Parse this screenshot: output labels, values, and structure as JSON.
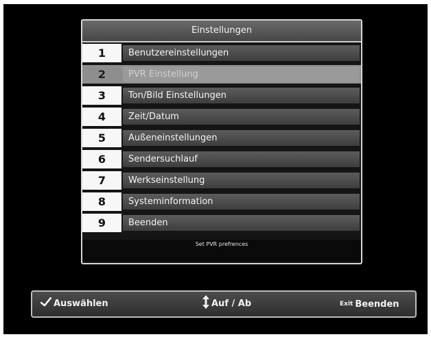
{
  "menu": {
    "title": "Einstellungen",
    "items": [
      {
        "num": "1",
        "label": "Benutzereinstellungen"
      },
      {
        "num": "2",
        "label": "PVR Einstellung"
      },
      {
        "num": "3",
        "label": "Ton/Bild Einstellungen"
      },
      {
        "num": "4",
        "label": "Zeit/Datum"
      },
      {
        "num": "5",
        "label": "Außeneinstellungen"
      },
      {
        "num": "6",
        "label": "Sendersuchlauf"
      },
      {
        "num": "7",
        "label": "Werkseinstellung"
      },
      {
        "num": "8",
        "label": "Systeminformation"
      },
      {
        "num": "9",
        "label": "Beenden"
      }
    ],
    "selected_index": 1,
    "hint": "Set PVR prefrences"
  },
  "footer": {
    "select": {
      "icon": "checkmark-icon",
      "label": "Auswählen"
    },
    "navigate": {
      "icon": "up-down-arrows-icon",
      "label": "Auf / Ab"
    },
    "exit": {
      "icon": "exit-key-icon",
      "icon_text": "Exit",
      "label": "Beenden"
    }
  }
}
